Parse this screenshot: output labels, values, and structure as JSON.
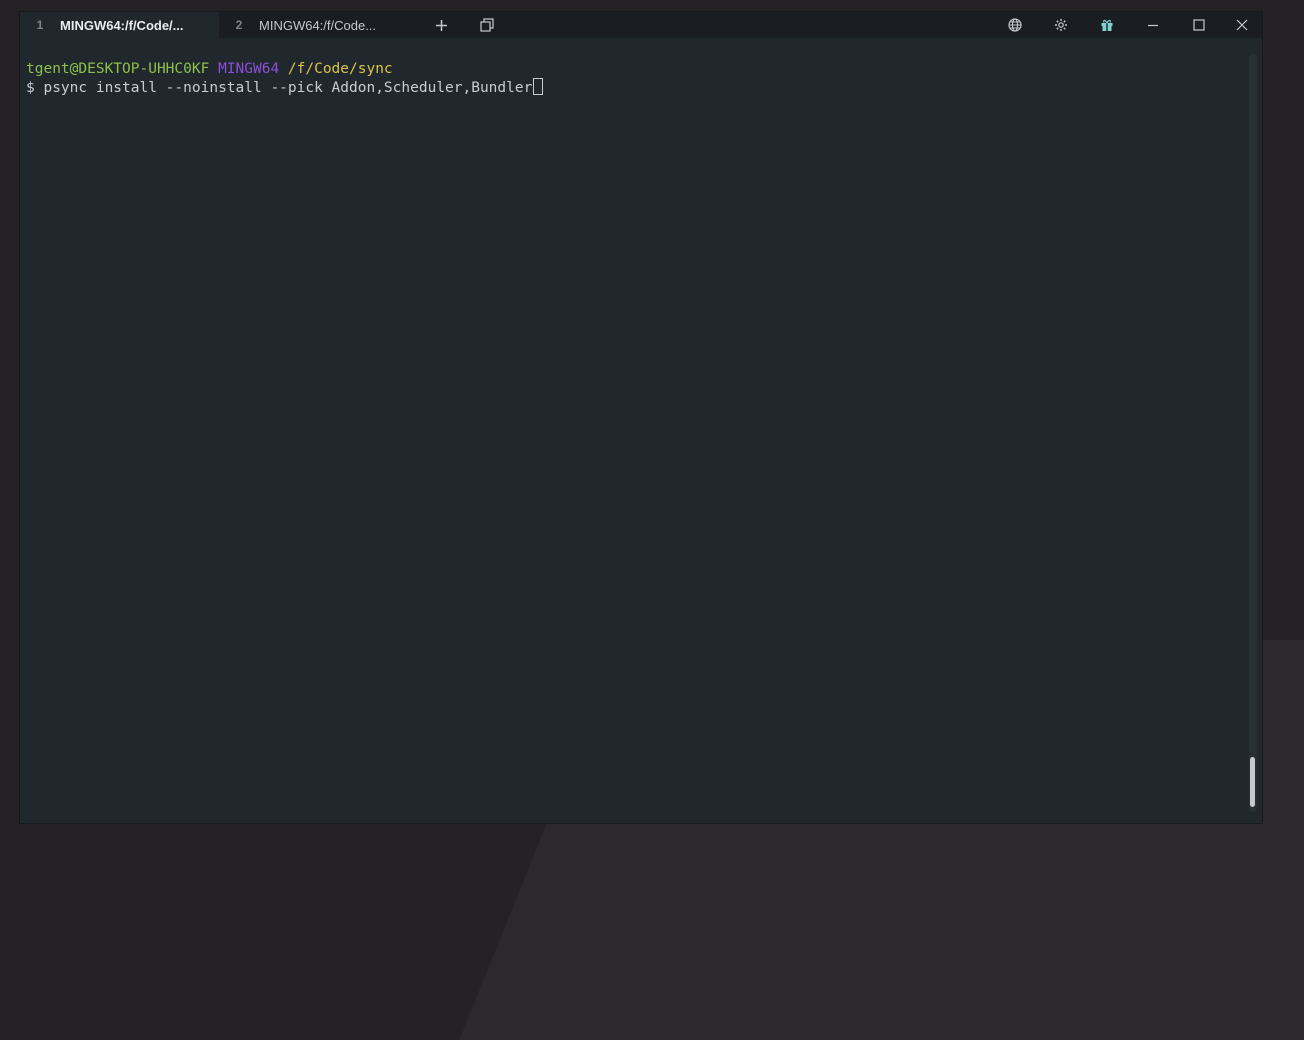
{
  "tabs": [
    {
      "number": "1",
      "title": "MINGW64:/f/Code/...",
      "active": true
    },
    {
      "number": "2",
      "title": "MINGW64:/f/Code..."
    }
  ],
  "icons": {
    "new_tab": "plus-icon",
    "tabs_overview": "copy-icon",
    "language": "globe-icon",
    "settings": "gear-icon",
    "gift": "gift-icon",
    "minimize": "minimize-icon",
    "maximize": "maximize-icon",
    "close": "close-icon"
  },
  "terminal": {
    "user_host": "tgent@DESKTOP-UHHC0KF",
    "system": "MINGW64",
    "cwd": "/f/Code/sync",
    "prompt_symbol": "$",
    "command": "psync install --noinstall --pick Addon,Scheduler,Bundler"
  },
  "colors": {
    "user_host": "#8dc149",
    "system": "#8b4fd9",
    "cwd": "#d9c54a",
    "background": "#20272d",
    "gift_icon": "#7fd3d3"
  }
}
